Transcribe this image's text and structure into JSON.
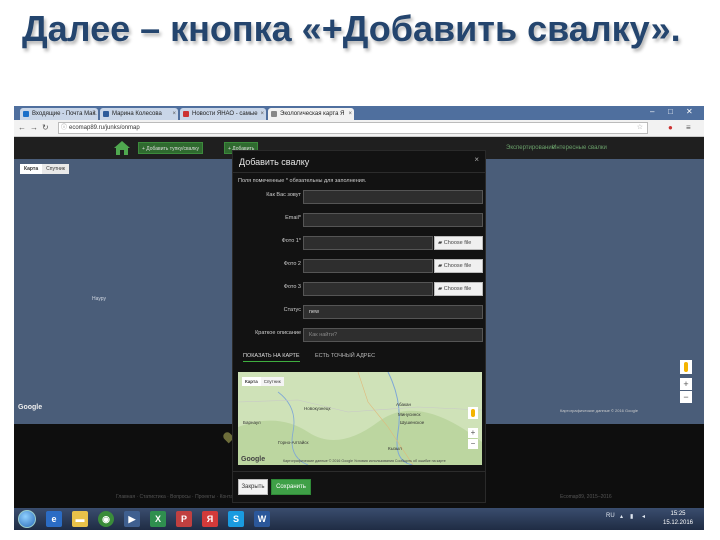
{
  "slide": {
    "title": "Далее – кнопка «+Добавить свалку»."
  },
  "browser": {
    "tabs": [
      {
        "label": "Входящие - Почта Mail.",
        "active": false
      },
      {
        "label": "Марина Колесова",
        "active": false
      },
      {
        "label": "Новости ЯНАО - самые",
        "active": false
      },
      {
        "label": "Экологическая карта Я",
        "active": true
      }
    ],
    "url": "ecomap89.ru/junks/onmap"
  },
  "site": {
    "add_button": "+ Добавить тупку/свалку",
    "second_button": "+ Добавить",
    "links": [
      "Экспертирование",
      "Интересные свалки"
    ],
    "footer_text": "Главная · Статистика · Вопросы · Проекты · Контакты",
    "footer_right": "Ecomap89, 2015–2016"
  },
  "mainmap": {
    "toggle": {
      "map": "Карта",
      "satellite": "Спутник"
    },
    "labels": [
      "Науру"
    ],
    "google": "Google",
    "attribution": "Картографические данные © 2016 Google"
  },
  "modal": {
    "title": "Добавить свалку",
    "close": "×",
    "hint": "Поля помеченные * обязательны для заполнения.",
    "fields": {
      "name": {
        "label": "Как Вас зовут",
        "value": ""
      },
      "email": {
        "label": "Email*",
        "value": ""
      },
      "photo1": {
        "label": "Фото 1*",
        "button": "Choose file"
      },
      "photo2": {
        "label": "Фото 2",
        "button": "Choose file"
      },
      "photo3": {
        "label": "Фото 3",
        "button": "Choose file"
      },
      "status": {
        "label": "Статус",
        "value": "new"
      },
      "description": {
        "label": "Краткое описание",
        "placeholder": "Как найти?"
      }
    },
    "tabs": [
      "ПОКАЗАТЬ НА КАРТЕ",
      "ЕСТЬ ТОЧНЫЙ АДРЕС"
    ],
    "minimap": {
      "toggle": {
        "map": "Карта",
        "satellite": "Спутник"
      },
      "cities": [
        "Новокузнецк",
        "Абакан",
        "Минусинск",
        "Шушенское",
        "Барнаул",
        "Кызыл",
        "Горно-Алтайск"
      ],
      "google": "Google",
      "attribution": "Картографические данные © 2016 Google   Условия использования   Сообщить об ошибке на карте"
    },
    "buttons": {
      "close": "Закрыть",
      "save": "Сохранить"
    }
  },
  "taskbar": {
    "lang": "RU",
    "time": "15:25",
    "date": "15.12.2016"
  }
}
